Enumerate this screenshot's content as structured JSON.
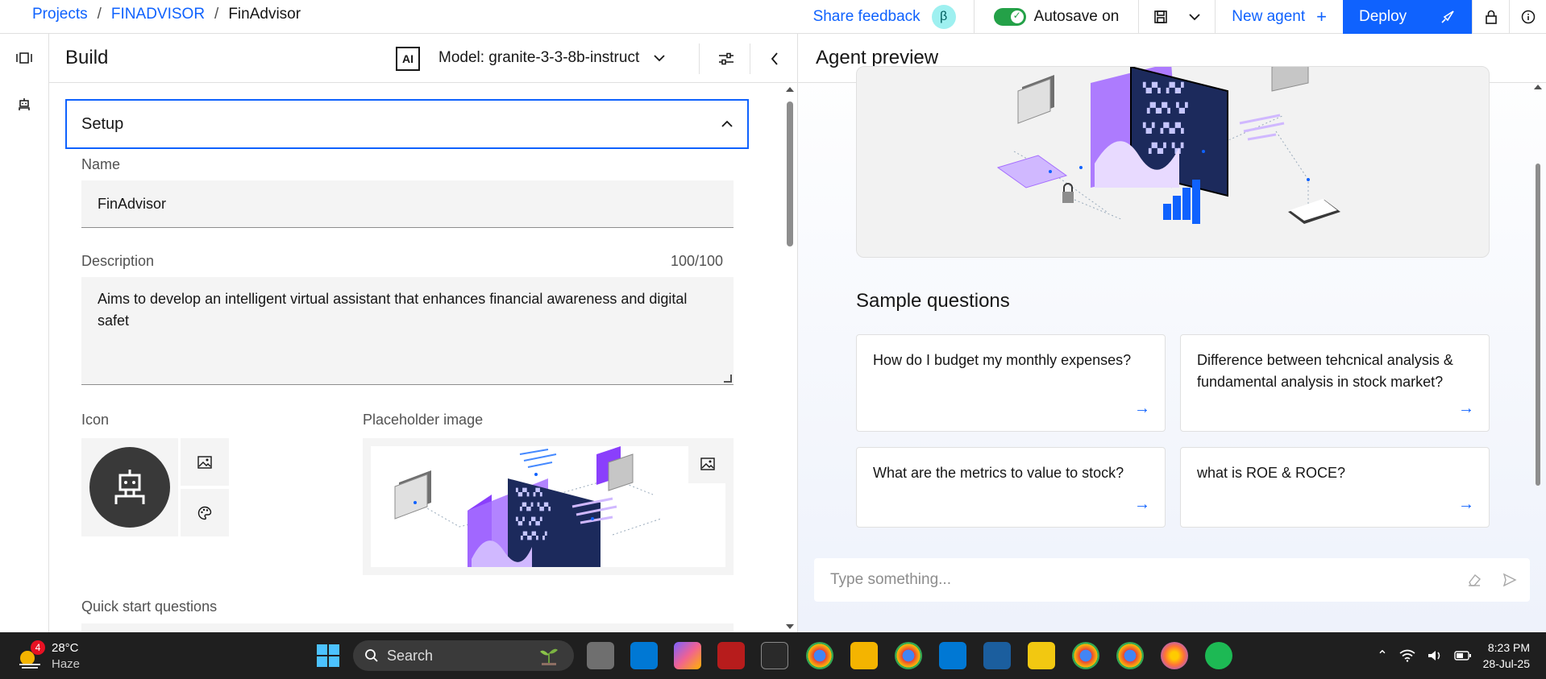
{
  "breadcrumb": {
    "projects": "Projects",
    "project": "FINADVISOR",
    "current": "FinAdvisor",
    "sep": "/"
  },
  "topbar": {
    "share_feedback": "Share feedback",
    "beta": "β",
    "autosave": "Autosave on",
    "new_agent": "New agent",
    "new_agent_plus": "+",
    "deploy": "Deploy"
  },
  "build": {
    "title": "Build",
    "ai_badge": "AI",
    "model": "Model: granite-3-3-8b-instruct",
    "section": "Setup",
    "name_label": "Name",
    "name_value": "FinAdvisor",
    "desc_label": "Description",
    "desc_counter": "100/100",
    "desc_value": "Aims to develop an intelligent virtual assistant that enhances financial awareness and digital safet",
    "icon_label": "Icon",
    "placeholder_label": "Placeholder image",
    "quick_label": "Quick start questions"
  },
  "preview": {
    "title": "Agent preview",
    "sample_title": "Sample questions",
    "questions": [
      "How do I budget my monthly expenses?",
      "Difference between tehcnical analysis & fundamental analysis in stock market?",
      "What are the metrics to value to stock?",
      "what is ROE & ROCE?"
    ],
    "input_placeholder": "Type something..."
  },
  "taskbar": {
    "weather_badge": "4",
    "temp": "28°C",
    "condition": "Haze",
    "search": "Search",
    "time": "8:23 PM",
    "date": "28-Jul-25"
  },
  "colors": {
    "accent": "#0f62fe",
    "toggle_on": "#24a148",
    "taskbar": "#1f1f1f",
    "illustration_purple": "#a56eff"
  }
}
